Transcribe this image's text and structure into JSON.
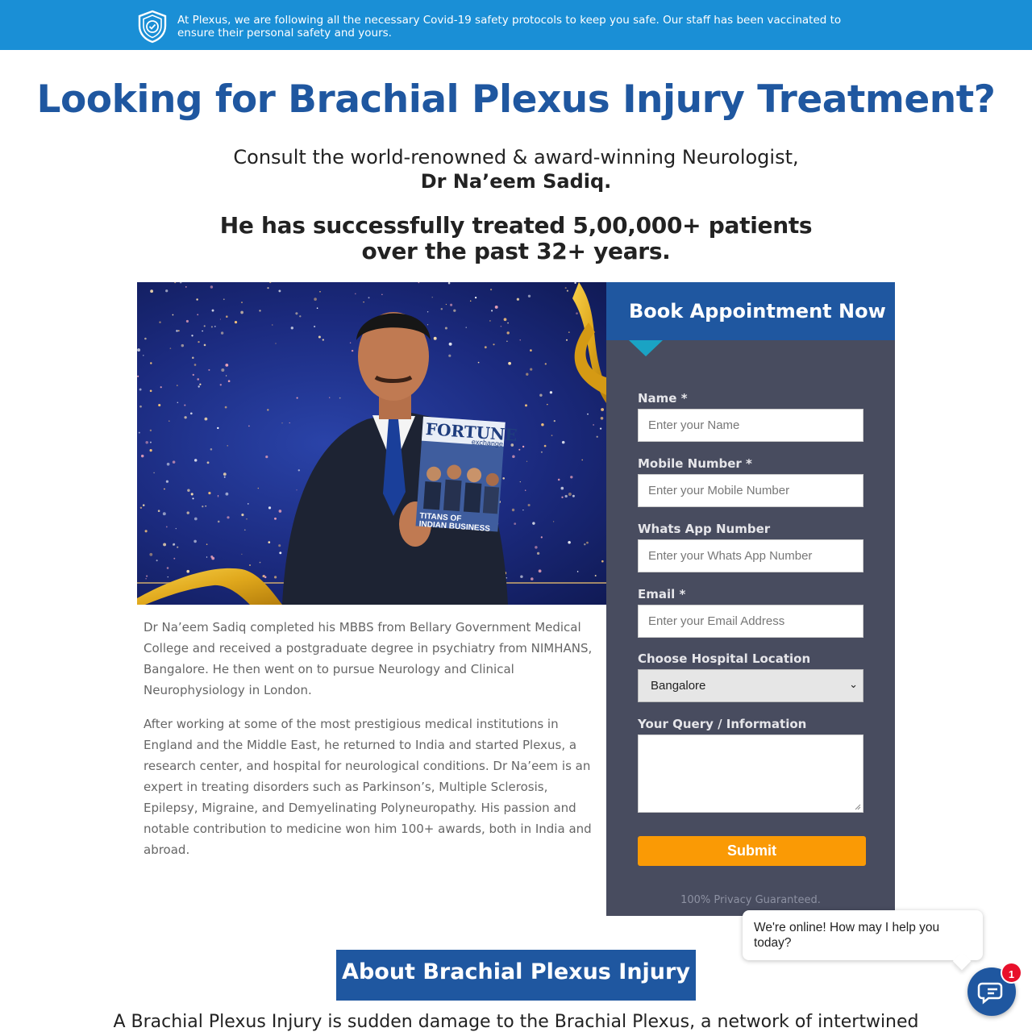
{
  "notice": {
    "icon": "shield-check-icon",
    "text": "At Plexus, we are following all the necessary Covid-19 safety protocols to keep you safe. Our staff has been vaccinated to ensure their personal safety and yours."
  },
  "headline": "Looking for Brachial Plexus Injury Treatment?",
  "consult": {
    "line1": "Consult  the world-renowned & award-winning Neurologist,",
    "doctor": "Dr Na’eem Sadiq."
  },
  "treated": "He has successfully treated 5,00,000+ patients over the past 32+ years.",
  "hero": {
    "magazine_title": "FORTUNE",
    "magazine_sub": "exchange",
    "magazine_caption1": "TITANS OF",
    "magazine_caption2": "INDIAN BUSINESS"
  },
  "bio": {
    "p1": "Dr Na’eem Sadiq completed his MBBS from Bellary Government Medical College and received a postgraduate degree in psychiatry from NIMHANS, Bangalore. He then went on to pursue Neurology and Clinical Neurophysiology in London.",
    "p2": "After working at some of the most prestigious medical institutions in England and the Middle East, he returned to India and started Plexus, a research center, and hospital for neurological conditions. Dr Na’eem is an expert in treating disorders such as Parkinson’s, Multiple Sclerosis, Epilepsy, Migraine, and Demyelinating Polyneuropathy. His passion and notable contribution to medicine won him 100+ awards, both in India and abroad."
  },
  "form": {
    "title": "Book Appointment Now",
    "name_label": "Name *",
    "name_placeholder": "Enter your Name",
    "mobile_label": "Mobile Number *",
    "mobile_placeholder": "Enter your Mobile Number",
    "whatsapp_label": "Whats App Number",
    "whatsapp_placeholder": "Enter your Whats App Number",
    "email_label": "Email *",
    "email_placeholder": "Enter your Email Address",
    "location_label": "Choose Hospital Location",
    "location_value": "Bangalore",
    "query_label": "Your Query / Information",
    "submit": "Submit",
    "privacy": "100% Privacy Guaranteed."
  },
  "about": {
    "button": "About Brachial Plexus Injury",
    "text": "A Brachial Plexus Injury is sudden damage to the Brachial Plexus, a network of intertwined"
  },
  "chat": {
    "message": "We're online! How may I help you today?",
    "badge": "1",
    "icon": "chat-icon"
  },
  "colors": {
    "brand_blue": "#1f57a0",
    "notice_blue": "#1a8fd6",
    "form_bg": "#484c5f",
    "submit_orange": "#fa9a05",
    "badge_red": "#e8102b"
  }
}
